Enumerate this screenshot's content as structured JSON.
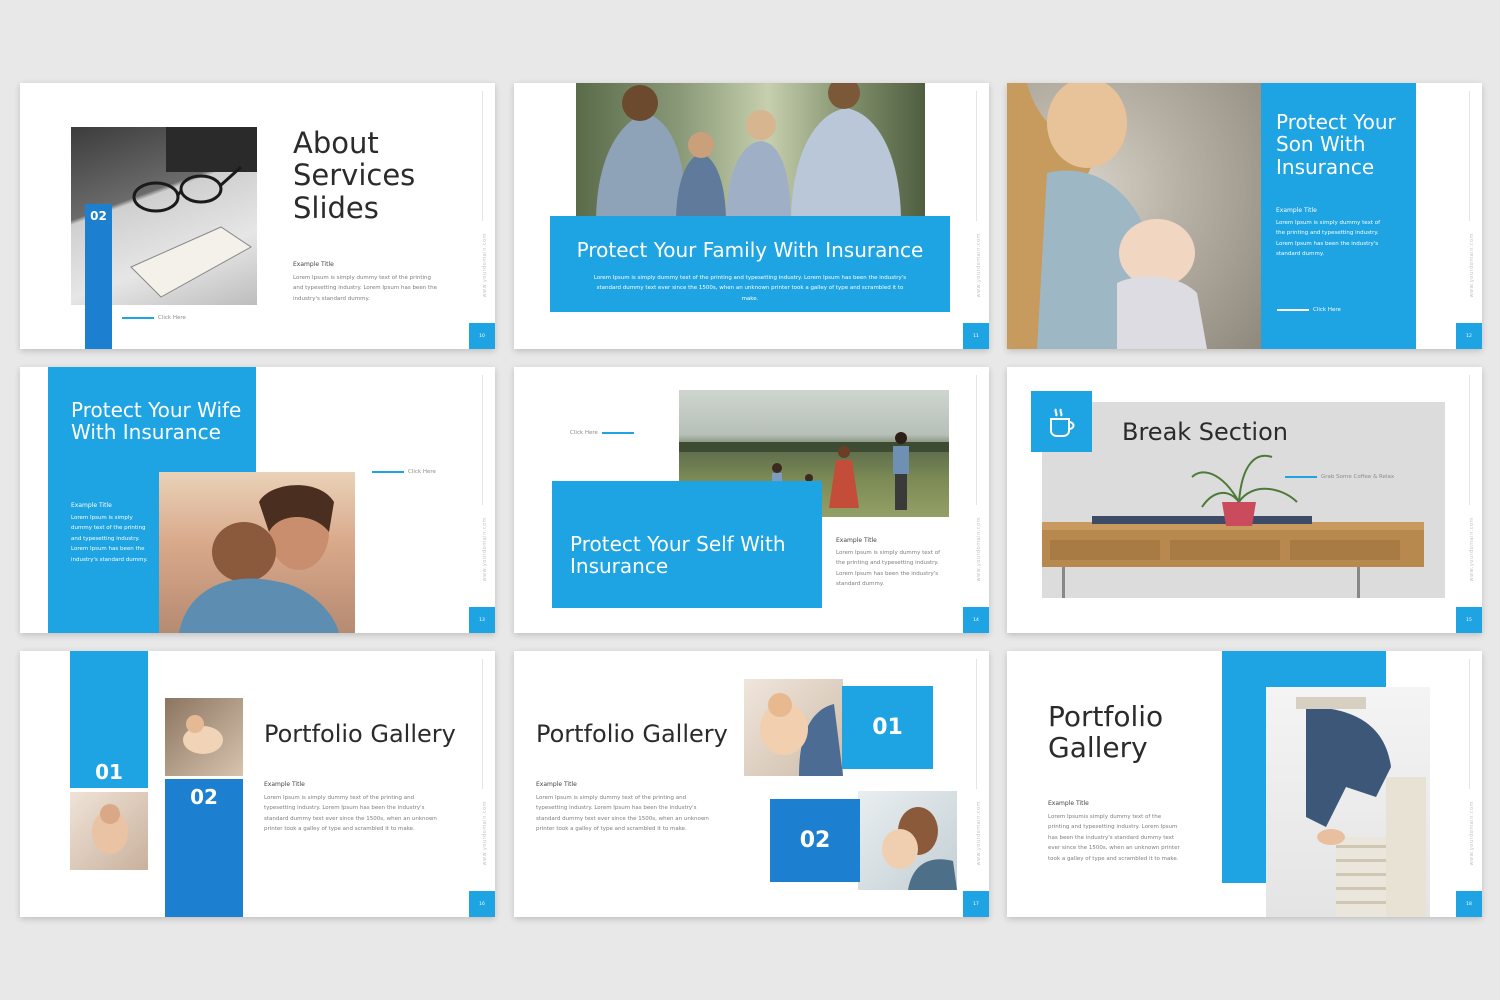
{
  "common": {
    "website": "www.yourdomain.com",
    "example_title": "Example Title",
    "click_here": "Click Here",
    "lorem_long": "Lorem Ipsum is simply dummy text of the printing and typesetting industry. Lorem Ipsum has been the industry's standard dummy.",
    "lorem_portfolio": "Lorem Ipsum is simply dummy text of the printing and typesetting industry. Lorem Ipsum has been the industry's standard dummy text ever since the 1500s, when an unknown printer took a galley of type and scrambled it to make.",
    "lorem_family": "Lorem Ipsum is simply dummy text of the printing and typesetting industry. Lorem Ipsum has been the industry's standard dummy text ever since the 1500s, when an unknown printer took a galley of type and scrambled it to make.",
    "lorem_gallery3": "Lorem Ipsumis simply dummy text of the printing and typesetting industry. Lorem Ipsum has been the industry's standard dummy text ever since the 1500s, when an unknown printer took a galley of type and scrambled it to make."
  },
  "slides": [
    {
      "title": "About Services Slides",
      "badge": "02",
      "page": "10"
    },
    {
      "title": "Protect Your Family With Insurance",
      "page": "11"
    },
    {
      "title": "Protect Your Son With Insurance",
      "page": "12"
    },
    {
      "title": "Protect Your Wife With Insurance",
      "page": "13"
    },
    {
      "title": "Protect Your Self With Insurance",
      "page": "14"
    },
    {
      "title": "Break Section",
      "subtitle": "Grab Some Coffee & Relax",
      "page": "15"
    },
    {
      "title": "Portfolio Gallery",
      "num1": "01",
      "num2": "02",
      "page": "16"
    },
    {
      "title": "Portfolio Gallery",
      "num1": "01",
      "num2": "02",
      "page": "17"
    },
    {
      "title": "Portfolio Gallery",
      "page": "18"
    }
  ],
  "colors": {
    "accent": "#1ea3e3",
    "accent_dark": "#1c7fd0",
    "background": "#e8e8e8"
  }
}
